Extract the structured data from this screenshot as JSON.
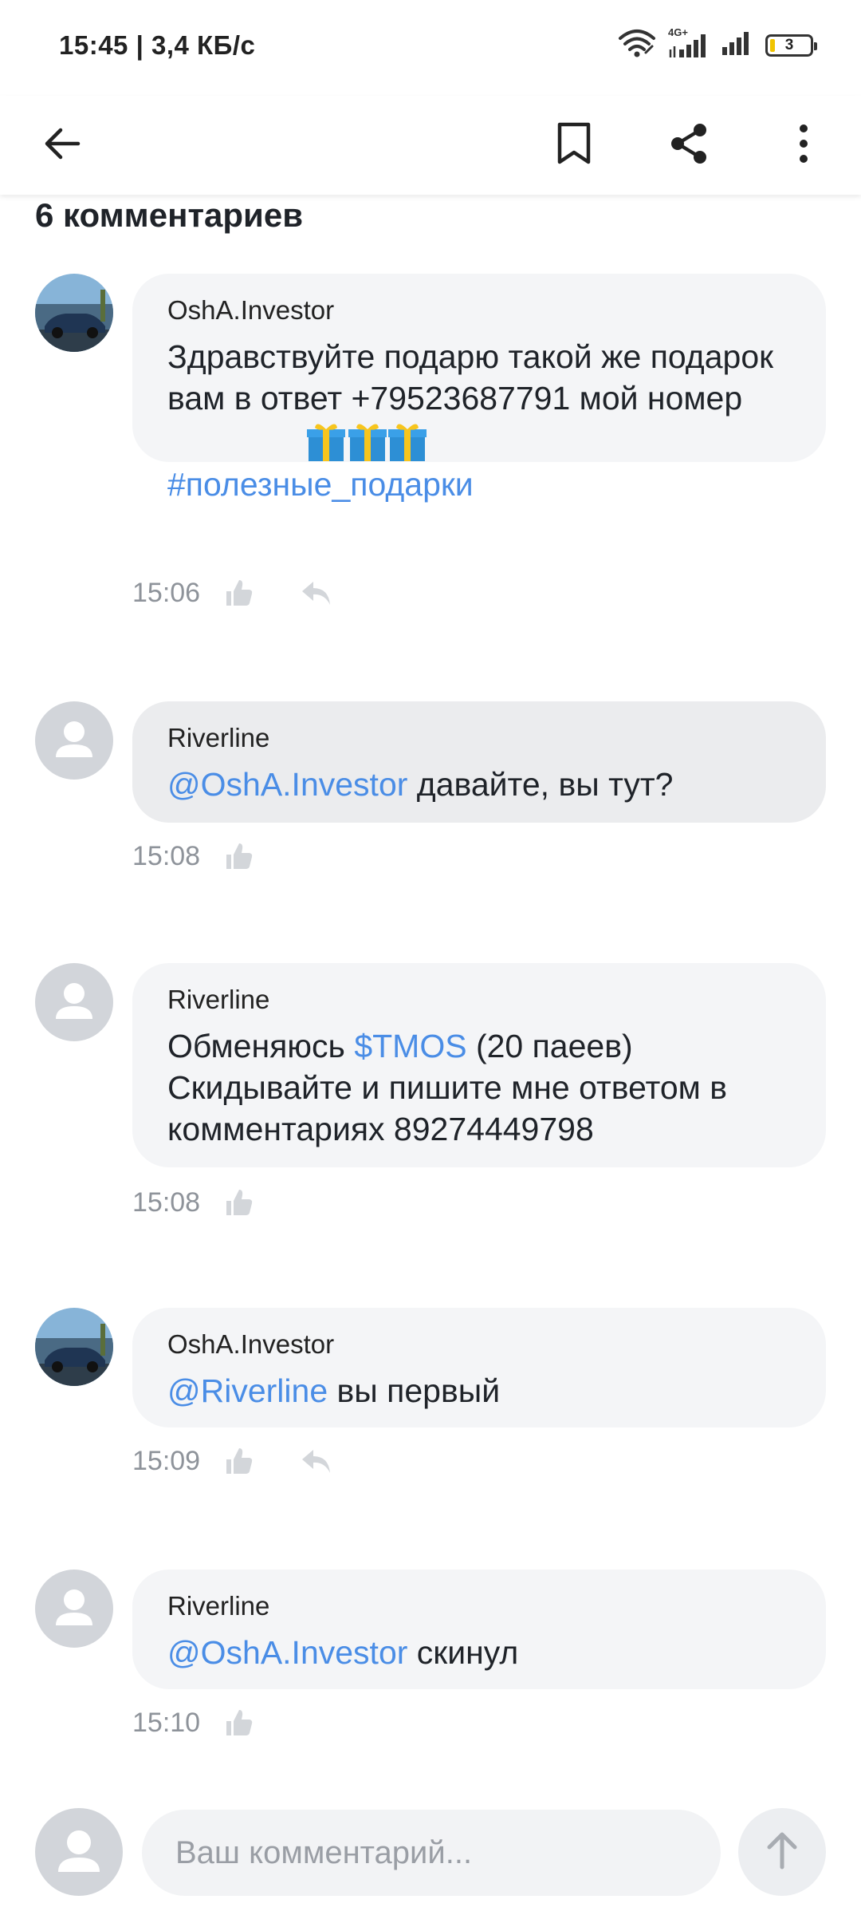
{
  "status_bar": {
    "time_speed": "15:45 | 3,4 КБ/с",
    "network": "4G+",
    "battery": "3",
    "icons": [
      "wifi-icon",
      "signal-icon",
      "signal-icon",
      "battery-icon"
    ]
  },
  "toolbar": {
    "icons": [
      "back-arrow-icon",
      "bookmark-icon",
      "share-icon",
      "more-vertical-icon"
    ]
  },
  "comments_header": "6 комментариев",
  "comments": [
    {
      "author": "OshA.Investor",
      "avatar": "car-photo",
      "text": "Здравствуйте подарю такой же подарок  вам в ответ +79523687791 мой номер",
      "emoji": "🎁🎁🎁",
      "hashtag": "#полезные_подарки",
      "time": "15:06",
      "actions": [
        "like-icon",
        "reply-icon"
      ]
    },
    {
      "author": "Riverline",
      "avatar": "placeholder",
      "mention": "@OshA.Investor",
      "text": " давайте, вы тут?",
      "time": "15:08",
      "actions": [
        "like-icon"
      ]
    },
    {
      "author": "Riverline",
      "avatar": "placeholder",
      "text_before": "Обменяюсь ",
      "ticker": "$TMOS",
      "text_after": " (20 паеев)\nСкидывайте и пишите мне ответом в комментариях 89274449798",
      "time": "15:08",
      "actions": [
        "like-icon"
      ]
    },
    {
      "author": "OshA.Investor",
      "avatar": "car-photo",
      "mention": "@Riverline",
      "text": " вы первый",
      "time": "15:09",
      "actions": [
        "like-icon",
        "reply-icon"
      ]
    },
    {
      "author": "Riverline",
      "avatar": "placeholder",
      "mention": "@OshA.Investor",
      "text": " скинул",
      "time": "15:10",
      "actions": [
        "like-icon"
      ]
    }
  ],
  "composer": {
    "placeholder": "Ваш комментарий...",
    "icons": [
      "avatar-placeholder-icon",
      "send-arrow-icon"
    ]
  },
  "colors": {
    "link": "#4a8de6",
    "bubble": "#f4f5f7",
    "bubble_highlight": "#ebecee",
    "avatar_placeholder": "#d2d5da",
    "meta_text": "#8e939a"
  }
}
